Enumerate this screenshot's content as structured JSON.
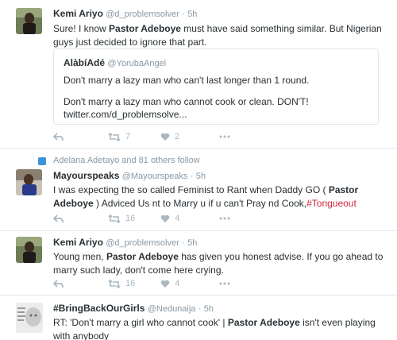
{
  "tweets": [
    {
      "name": "Kemi Ariyo",
      "handle": "@d_problemsolver",
      "dot": "·",
      "time": "5h",
      "text_parts": [
        "Sure! I know ",
        "Pastor Adeboye",
        " must have said something similar. But Nigerian guys just decided to ignore that part."
      ],
      "quote": {
        "name": "AlàbíAdé",
        "handle": "@YorubaAngel",
        "line1": "Don't marry a lazy man who can't last longer than 1 round.",
        "line2": "Don't marry a lazy man who cannot cook or clean. DON'T!",
        "line3": "twitter.com/d_problemsolve..."
      },
      "retweets": "7",
      "likes": "2"
    },
    {
      "context": "Adelana Adetayo and 81 others follow",
      "name": "Mayourspeaks",
      "handle": "@Mayourspeaks",
      "dot": "·",
      "time": "5h",
      "text_parts": [
        "I was expecting the so called Feminist to Rant when Daddy GO ( ",
        "Pastor Adeboye",
        " ) Adviced Us nt to Marry u if u can't Pray nd Cook,",
        "#Tongueout"
      ],
      "retweets": "16",
      "likes": "4"
    },
    {
      "name": "Kemi Ariyo",
      "handle": "@d_problemsolver",
      "dot": "·",
      "time": "5h",
      "text_parts": [
        "Young men, ",
        "Pastor Adeboye",
        " has given you honest advise. If you go ahead to marry such lady, don't come here crying."
      ],
      "retweets": "16",
      "likes": "4"
    },
    {
      "name": "#BringBackOurGirls",
      "handle": "@Nedunaija",
      "dot": "·",
      "time": "5h",
      "text_parts": [
        "RT:  'Don't marry a girl who cannot cook' | ",
        "Pastor Adeboye",
        " isn't even playing with anybody"
      ]
    }
  ],
  "colors": {
    "hashtag": "#d3273d",
    "meta": "#8899a6",
    "border": "#e1e8ed",
    "verified_ctx": "#3b94d9"
  },
  "icons": [
    "reply-icon",
    "retweet-icon",
    "heart-icon",
    "more-icon",
    "follow-context-icon"
  ]
}
